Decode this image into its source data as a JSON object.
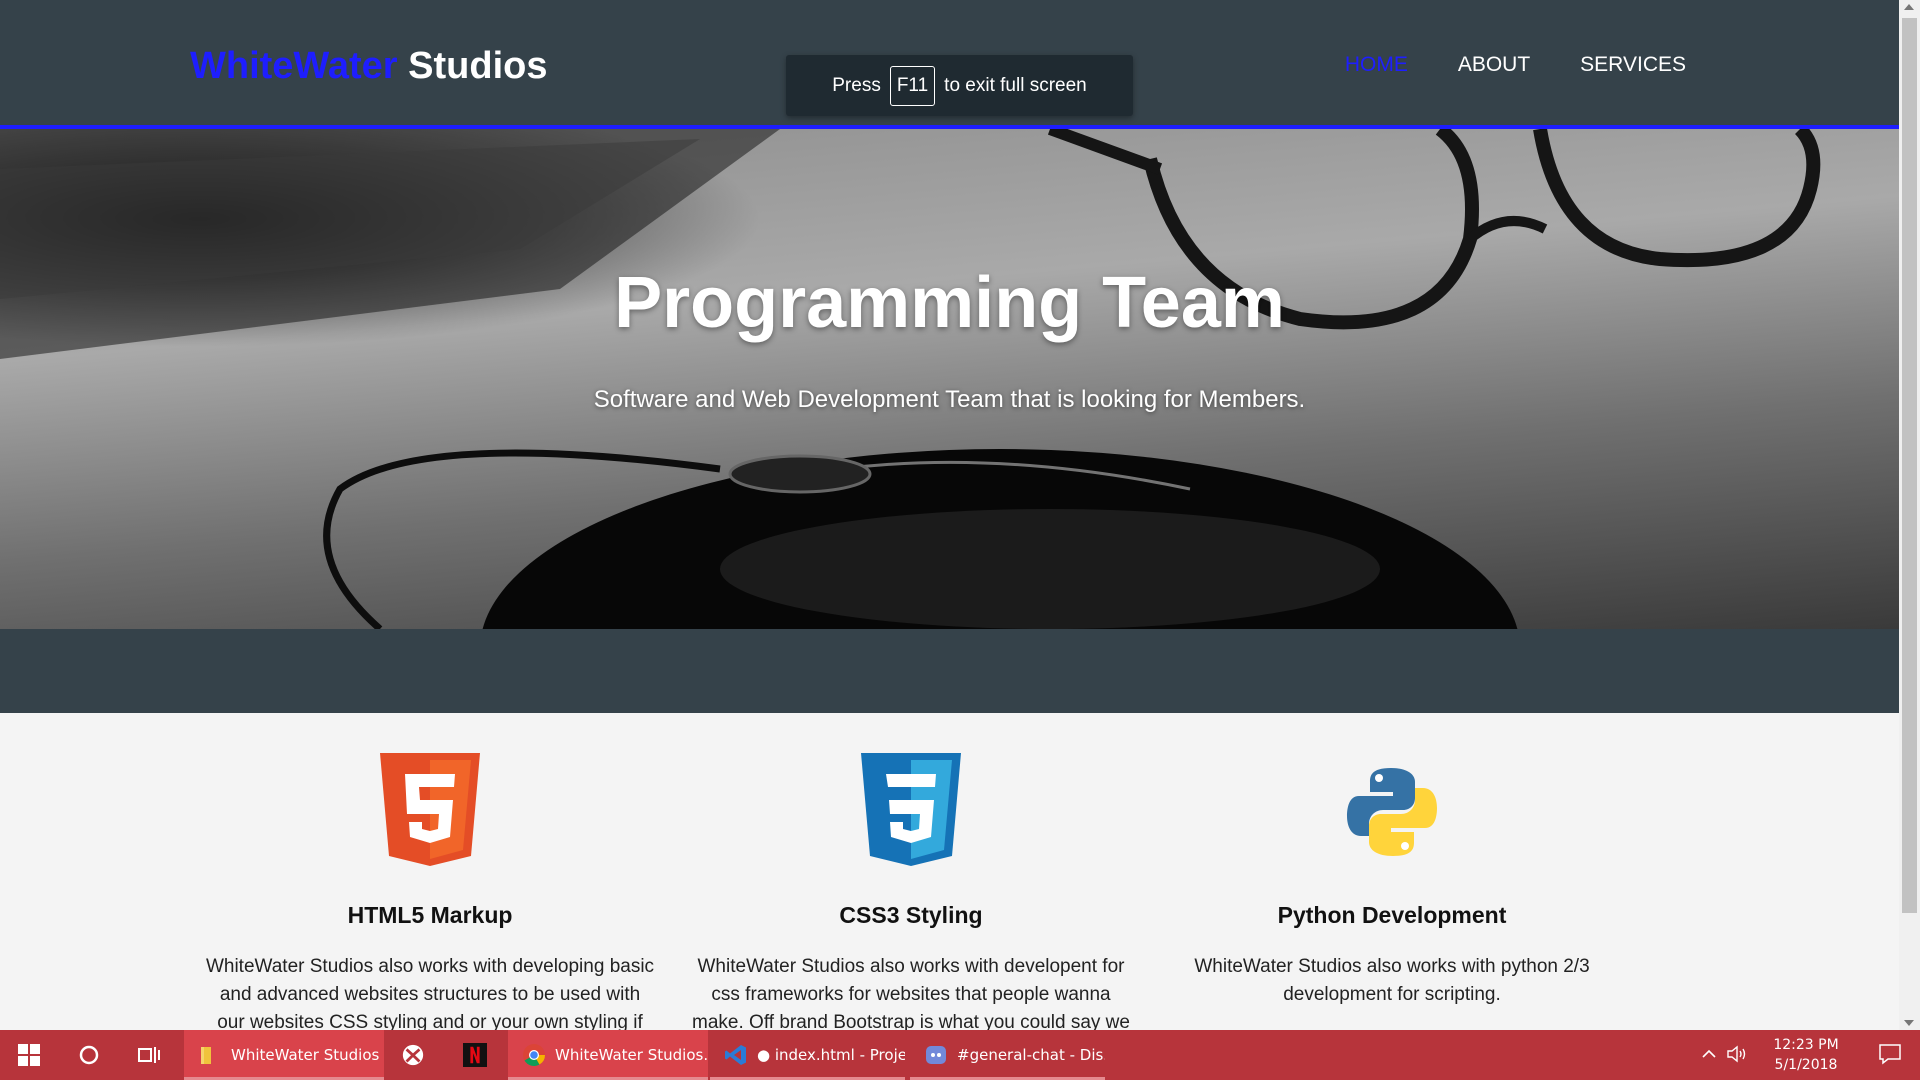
{
  "header": {
    "brand_highlight": "WhiteWater",
    "brand_rest": " Studios",
    "nav": [
      {
        "label": "Home",
        "active": true
      },
      {
        "label": "About",
        "active": false
      },
      {
        "label": "Services",
        "active": false
      }
    ],
    "accent_color": "#1e1eff"
  },
  "fullscreen_toast": {
    "prefix": "Press",
    "key": "F11",
    "suffix": "to exit full screen"
  },
  "hero": {
    "title": "Programming Team",
    "subtitle": "Software and Web Development Team that is looking for Members."
  },
  "services": [
    {
      "icon": "html5-icon",
      "title": "HTML5 Markup",
      "text": "WhiteWater Studios also works with developing basic and advanced websites structures to be used with our websites CSS styling and or your own styling if you"
    },
    {
      "icon": "css3-icon",
      "title": "CSS3 Styling",
      "text": "WhiteWater Studios also works with developent for css frameworks for websites that people wanna make. Off brand Bootstrap is what you could say we do."
    },
    {
      "icon": "python-icon",
      "title": "Python Development",
      "text": "WhiteWater Studios also works with python 2/3 development for scripting."
    }
  ],
  "taskbar": {
    "apps": [
      {
        "name": "file-explorer",
        "label": "WhiteWater Studios",
        "icon": "folder-icon"
      },
      {
        "name": "xbox",
        "label": "",
        "icon": "xbox-icon"
      },
      {
        "name": "netflix",
        "label": "",
        "icon": "netflix-icon"
      },
      {
        "name": "chrome",
        "label": "WhiteWater Studios...",
        "icon": "chrome-icon"
      },
      {
        "name": "vscode",
        "label": "● index.html - Proje...",
        "icon": "vscode-icon"
      },
      {
        "name": "discord",
        "label": "#general-chat - Dis...",
        "icon": "discord-icon"
      }
    ],
    "clock_time": "12:23 PM",
    "clock_date": "5/1/2018"
  }
}
